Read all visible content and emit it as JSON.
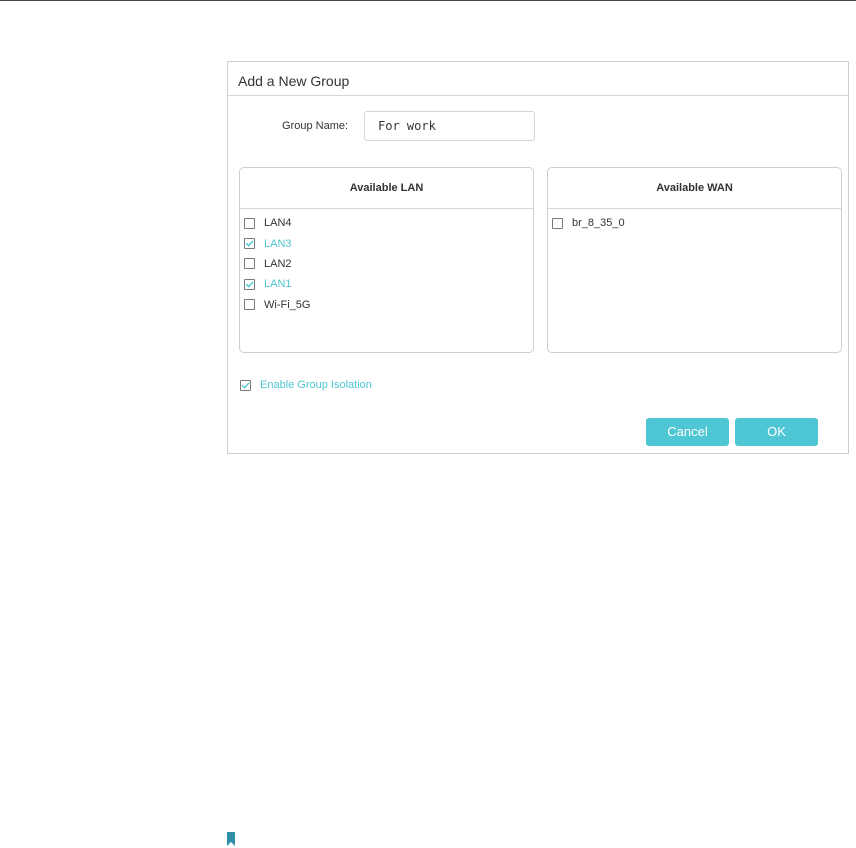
{
  "dialog": {
    "title": "Add a New Group",
    "group_name_label": "Group Name:",
    "group_name_value": "For work"
  },
  "lan_panel": {
    "header": "Available LAN",
    "items": [
      {
        "label": "LAN4",
        "checked": false
      },
      {
        "label": "LAN3",
        "checked": true
      },
      {
        "label": "LAN2",
        "checked": false
      },
      {
        "label": "LAN1",
        "checked": true
      },
      {
        "label": "Wi-Fi_5G",
        "checked": false
      }
    ]
  },
  "wan_panel": {
    "header": "Available WAN",
    "items": [
      {
        "label": "br_8_35_0",
        "checked": false
      }
    ]
  },
  "isolation": {
    "label": "Enable Group Isolation",
    "checked": true
  },
  "buttons": {
    "cancel_label": "Cancel",
    "ok_label": "OK"
  },
  "colors": {
    "accent": "#4ec6d3",
    "text": "#333333",
    "border": "#cfcfcf",
    "bookmark": "#2f8fa6"
  },
  "icons": {
    "check": "check-icon",
    "bookmark": "bookmark-icon"
  }
}
